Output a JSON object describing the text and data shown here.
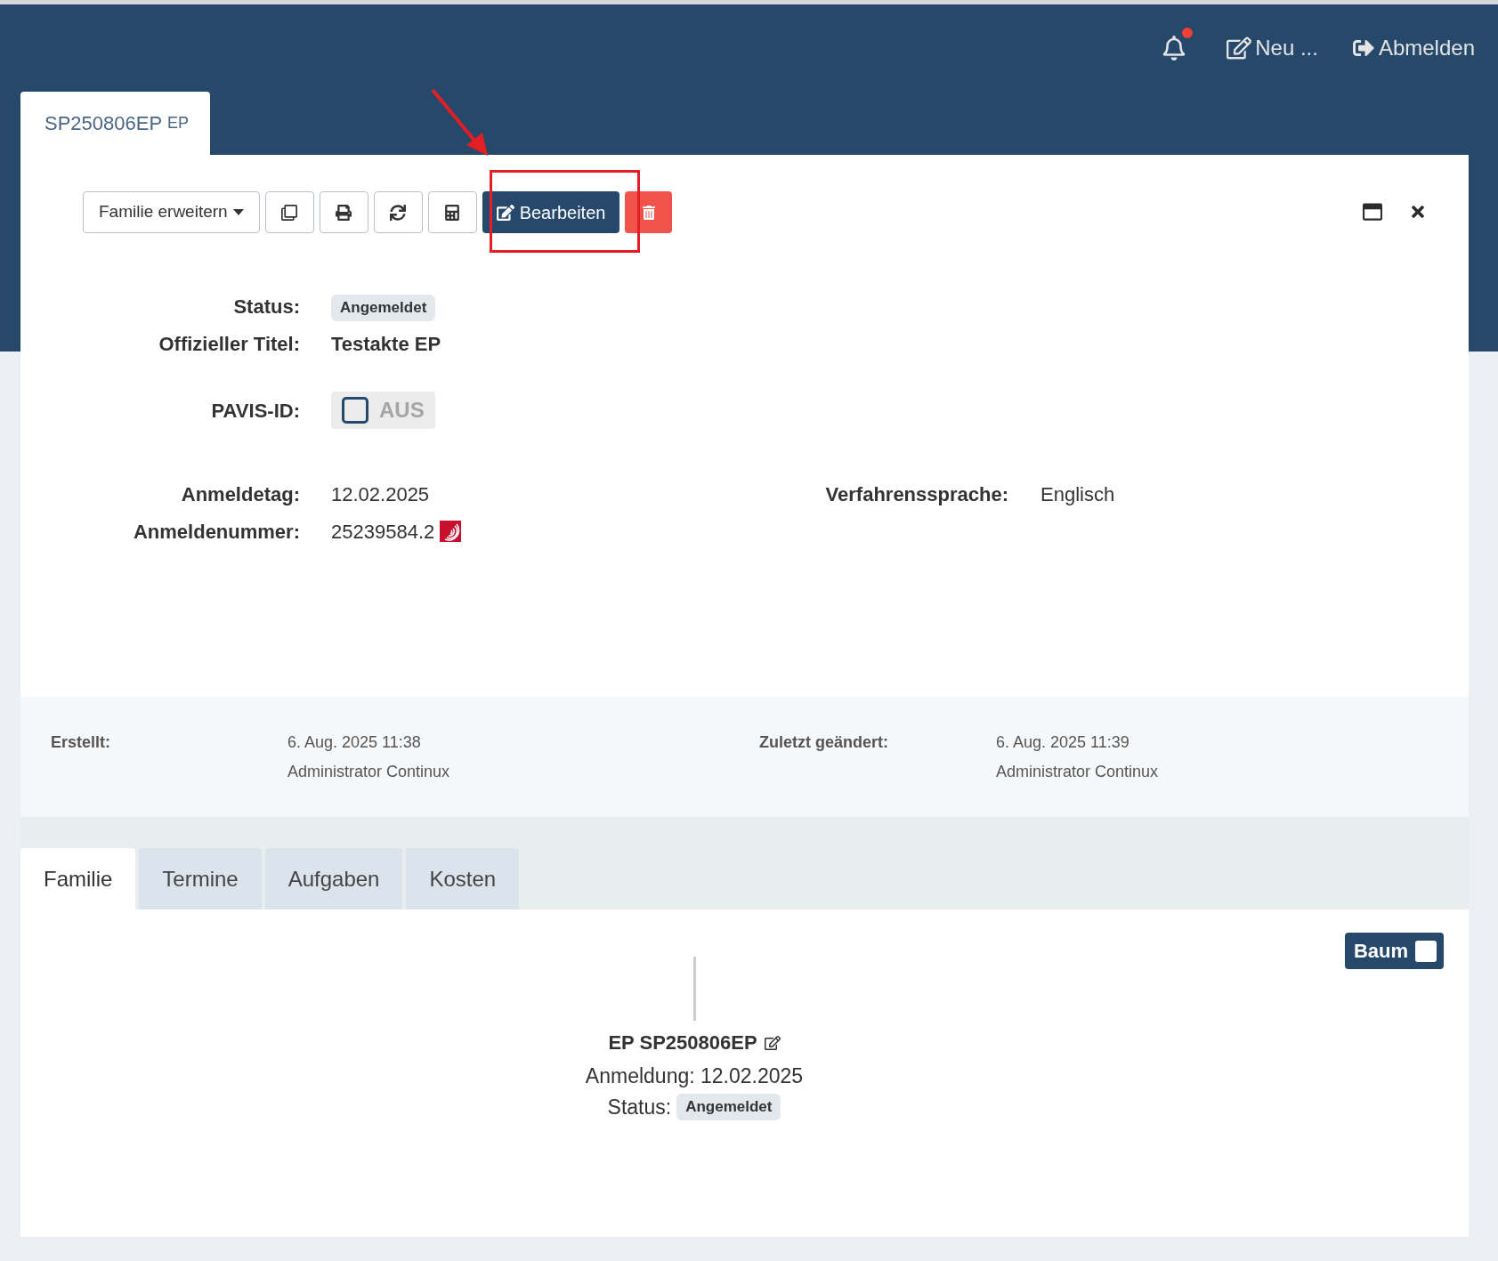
{
  "header": {
    "notifications": {
      "unread": true
    },
    "actions": [
      {
        "kind": "new",
        "label": "Neu ..."
      },
      {
        "kind": "logout",
        "label": "Abmelden"
      }
    ]
  },
  "document_tab": {
    "label": "SP250806EP",
    "suffix": "EP",
    "selected": true
  },
  "toolbar": [
    {
      "kind": "dropdown",
      "label": "Familie erweitern"
    },
    {
      "kind": "icon"
    },
    {
      "kind": "icon"
    },
    {
      "kind": "icon"
    },
    {
      "kind": "icon"
    },
    {
      "kind": "primary",
      "label": "Bearbeiten"
    },
    {
      "kind": "danger"
    }
  ],
  "fields": [
    {
      "label": "Status:",
      "kind": "badge",
      "value": "Angemeldet"
    },
    {
      "label": "Offizieller Titel:",
      "kind": "bold",
      "value": "Testakte EP"
    },
    {
      "label": "PAVIS-ID:",
      "kind": "toggle",
      "value": "AUS",
      "checked": false
    }
  ],
  "dates": [
    {
      "label": "Anmeldetag:",
      "value": "12.02.2025",
      "side_label": "Verfahrenssprache:",
      "side_value": "Englisch"
    },
    {
      "label": "Anmeldenummer:",
      "value": "25239584.2",
      "linked": true
    }
  ],
  "meta": [
    {
      "label": "Erstellt:",
      "date": "6. Aug. 2025 11:38",
      "user": "Administrator Continux"
    },
    {
      "label": "Zuletzt geändert:",
      "date": "6. Aug. 2025 11:39",
      "user": "Administrator Continux"
    }
  ],
  "tabs": [
    {
      "label": "Familie",
      "selected": true
    },
    {
      "label": "Termine",
      "selected": false
    },
    {
      "label": "Aufgaben",
      "selected": false
    },
    {
      "label": "Kosten",
      "selected": false
    }
  ],
  "tree": {
    "toggle": {
      "label": "Baum",
      "checked": false
    },
    "node": {
      "title": "EP SP250806EP",
      "filing": "Anmeldung: 12.02.2025",
      "status_label": "Status:",
      "status": "Angemeldet"
    }
  }
}
